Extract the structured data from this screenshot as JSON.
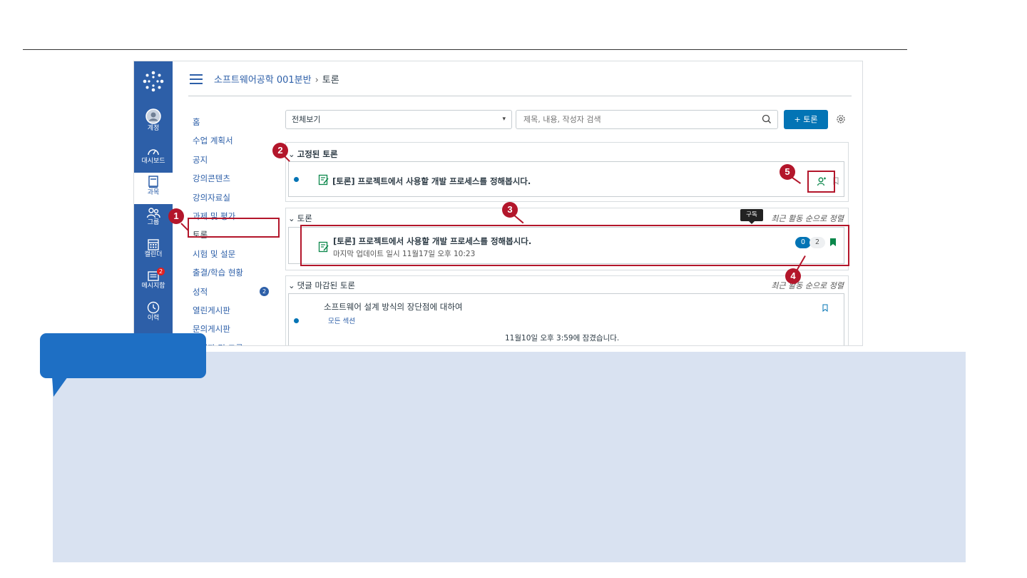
{
  "breadcrumb": {
    "course": "소프트웨어공학 001분반",
    "separator": "›",
    "page": "토론"
  },
  "global_nav": [
    {
      "label": "계정",
      "icon": "account-icon"
    },
    {
      "label": "대시보드",
      "icon": "dashboard-icon"
    },
    {
      "label": "과목",
      "icon": "courses-icon",
      "active": true
    },
    {
      "label": "그룹",
      "icon": "groups-icon"
    },
    {
      "label": "캘린더",
      "icon": "calendar-icon"
    },
    {
      "label": "메시지함",
      "icon": "inbox-icon",
      "badge": "2"
    },
    {
      "label": "이력",
      "icon": "history-icon"
    }
  ],
  "course_nav": [
    {
      "label": "홈"
    },
    {
      "label": "수업 계획서"
    },
    {
      "label": "공지"
    },
    {
      "label": "강의콘텐츠"
    },
    {
      "label": "강의자료실"
    },
    {
      "label": "과제 및 평가"
    },
    {
      "label": "토론",
      "active": true
    },
    {
      "label": "시험 및 설문"
    },
    {
      "label": "출결/학습 현황"
    },
    {
      "label": "성적",
      "badge": "2"
    },
    {
      "label": "열린게시판"
    },
    {
      "label": "문의게시판"
    },
    {
      "label": "참여자 및 그룹"
    }
  ],
  "toolbar": {
    "filter_value": "전체보기",
    "search_placeholder": "제목, 내용, 작성자 검색",
    "add_button": "+ 토론"
  },
  "sections": {
    "pinned": {
      "title": "고정된 토론",
      "item_title": "[토론] 프로젝트에서 사용할 개발 프로세스를 정해봅시다."
    },
    "discussions": {
      "title": "토론",
      "sort": "최근 활동 순으로 정렬",
      "tooltip": "구독",
      "item_title": "[토론] 프로젝트에서 사용할 개발 프로세스를 정해봅시다.",
      "item_sub": "마지막 업데이트 일시 11월17일 오후 10:23",
      "unread": "0",
      "total": "2"
    },
    "closed": {
      "title": "댓글 마감된 토론",
      "sort": "최근 활동 순으로 정렬",
      "item_title": "소프트웨어 설계 방식의 장단점에 대하여",
      "item_section": "모든 섹션",
      "item_locked": "11월10일 오후 3:59에 잠겼습니다."
    }
  },
  "callouts": [
    "1",
    "2",
    "3",
    "4",
    "5"
  ],
  "colors": {
    "nav_blue": "#2d5fa8",
    "primary": "#0374b5",
    "callout_red": "#b3162b",
    "panel": "#d9e2f1",
    "bubble": "#1e6fc4",
    "bookmark_green": "#0b874b"
  }
}
